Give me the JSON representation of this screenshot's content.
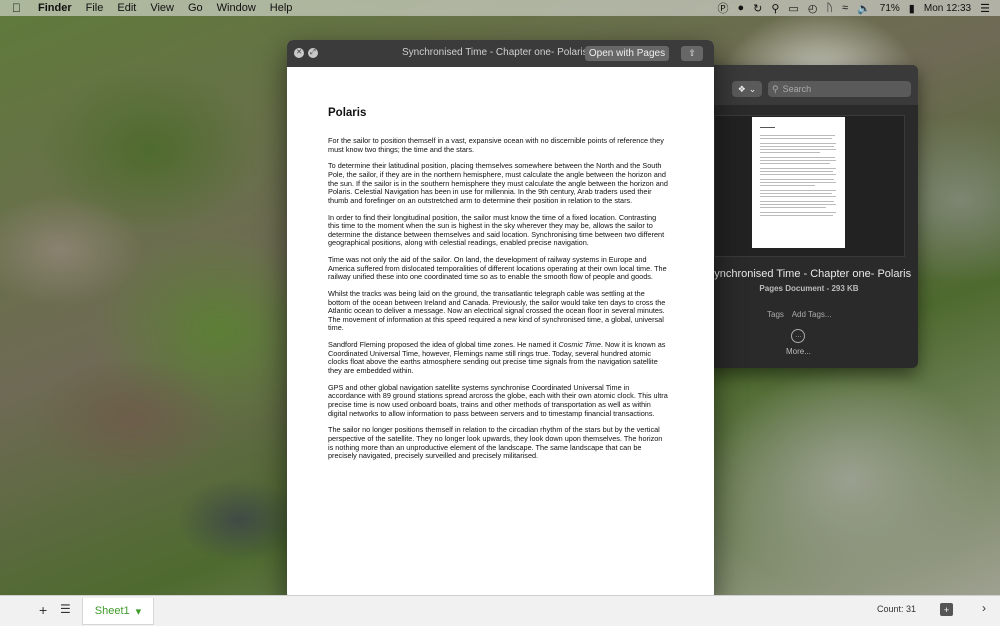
{
  "menubar": {
    "app": "Finder",
    "items": [
      "File",
      "Edit",
      "View",
      "Go",
      "Window",
      "Help"
    ],
    "battery": "71%",
    "clock": "Mon 12:33"
  },
  "finder_info": {
    "search_placeholder": "Search",
    "file_name": "Synchronised Time - Chapter one- Polaris",
    "file_kind": "Pages Document - 293 KB",
    "tags_label": "Tags",
    "add_tags": "Add Tags...",
    "more_label": "More..."
  },
  "quicklook": {
    "title": "Synchronised Time - Chapter one- Polaris",
    "open_button": "Open with Pages",
    "doc": {
      "heading": "Polaris",
      "p1": "For the sailor to position themself in a vast, expansive ocean with no discernible points of reference they must know two things; the time and the stars.",
      "p2": "To determine their latitudinal position, placing themselves somewhere between the North and the South Pole, the sailor, if they are in the northern hemisphere, must calculate the angle between the horizon and the sun. If the sailor is in the southern hemisphere they must calculate the angle between the horizon and Polaris. Celestial Navigation has been in use for millennia. In the 9th century, Arab traders used their thumb and forefinger on an outstretched arm to determine their position in relation to the stars.",
      "p3": "In order to find their longitudinal position, the sailor must know the time of a fixed location. Contrasting this time to the moment when the sun is highest in the sky wherever they may be, allows the sailor to determine the distance between themselves and said location. Synchronising time between two different geographical positions, along with celestial readings, enabled precise navigation.",
      "p4": "Time was not only the aid of the sailor. On land, the development of railway systems in Europe and America suffered from dislocated temporalities of different locations operating at their own local time. The railway unified these into one coordinated time so as to enable the smooth flow of people and goods.",
      "p5": "Whilst the tracks was being laid on the ground, the transatlantic telegraph cable was settling at the bottom of the ocean between Ireland and Canada. Previously, the sailor would take ten days to cross the Atlantic ocean to deliver a message. Now an electrical signal crossed the ocean floor in several minutes. The movement of information at this speed required a new kind of synchronised time, a global, universal time.",
      "p6_a": "Sandford Fleming proposed the idea of global time zones. He named it ",
      "p6_em": "Cosmic Time",
      "p6_b": ". Now it is known as Coordinated Universal Time, however, Flemings name still rings true. Today, several hundred atomic clocks float above the earths atmosphere sending out precise time signals from the navigation satellite they are embedded within.",
      "p7": "GPS and other global navigation satellite systems synchronise Coordinated Universal Time in accordance with 89 ground stations spread arcross the globe, each with their own atomic clock. This ultra precise time is now used onboard boats, trains and other methods of transportation as well as within digital networks to allow information to pass between servers and to timestamp financial transactions.",
      "p8": "The sailor no longer positions themself in relation to the circadian rhythm of the stars but by the vertical perspective of the satellite. They no longer look upwards, they look down upon themselves. The horizon is nothing more than an unproductive element of the landscape. The same landscape that can be precisely navigated, precisely surveilled and precisely militarised."
    }
  },
  "sheetbar": {
    "sheet_name": "Sheet1",
    "count": "Count: 31"
  }
}
